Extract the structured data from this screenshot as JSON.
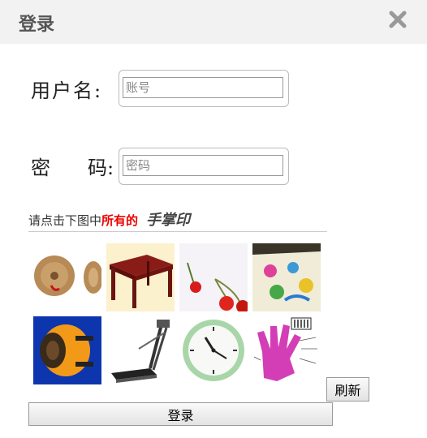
{
  "dialog": {
    "title": "登录",
    "close_icon": "close-icon"
  },
  "form": {
    "username_label": "用户名:",
    "password_label_first": "密",
    "password_label_second": "码:",
    "username_placeholder": "账号",
    "username_value": "",
    "password_placeholder": "密码",
    "password_value": ""
  },
  "captcha": {
    "prompt_prefix": "请点击下图中",
    "prompt_highlight": "所有的",
    "target_text": "手掌印",
    "images": [
      {
        "name": "cymbals-image"
      },
      {
        "name": "table-image"
      },
      {
        "name": "cherries-image"
      },
      {
        "name": "handprint-painting-image"
      },
      {
        "name": "fan-image"
      },
      {
        "name": "treadmill-image"
      },
      {
        "name": "clock-image"
      },
      {
        "name": "hand-drawing-image"
      }
    ],
    "refresh_label": "刷新"
  },
  "actions": {
    "login_label": "登录"
  },
  "colors": {
    "header_bg": "#f2f2f2",
    "highlight": "#ee0000"
  }
}
